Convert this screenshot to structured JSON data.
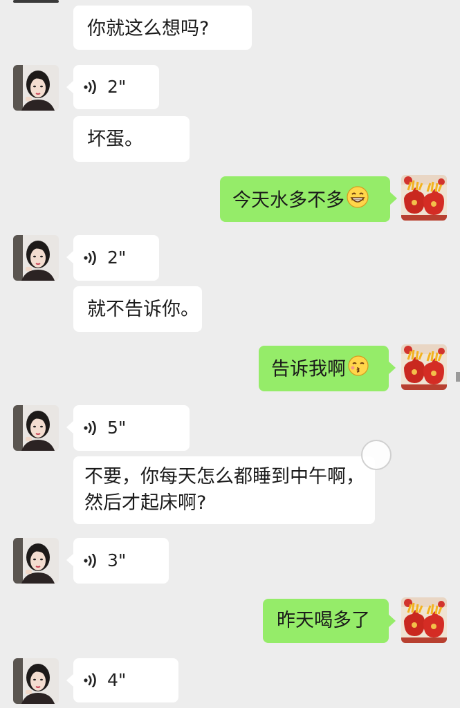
{
  "messages": [
    {
      "side": "in",
      "kind": "text",
      "text": "你就这么想吗?"
    },
    {
      "side": "in",
      "kind": "voice",
      "duration": "2\""
    },
    {
      "side": "in",
      "kind": "text",
      "text": "坏蛋。"
    },
    {
      "side": "out",
      "kind": "text",
      "text": "今天水多不多",
      "emoji": "grinning-emoji"
    },
    {
      "side": "in",
      "kind": "voice",
      "duration": "2\""
    },
    {
      "side": "in",
      "kind": "text",
      "text": "就不告诉你。"
    },
    {
      "side": "out",
      "kind": "text",
      "text": "告诉我啊",
      "emoji": "kissing-emoji"
    },
    {
      "side": "in",
      "kind": "voice",
      "duration": "5\""
    },
    {
      "side": "in",
      "kind": "text",
      "line1": "不要，你每天怎么都睡到中午啊，",
      "line2": "然后才起床啊?"
    },
    {
      "side": "in",
      "kind": "voice",
      "duration": "3\""
    },
    {
      "side": "out",
      "kind": "text",
      "text": "昨天喝多了"
    },
    {
      "side": "in",
      "kind": "voice",
      "duration": "4\""
    }
  ],
  "colors": {
    "background": "#ededed",
    "incoming_bubble": "#ffffff",
    "outgoing_bubble": "#95ec69"
  },
  "icons": {
    "voice": "voice-wave-icon",
    "contact_avatar": "woman-portrait-avatar",
    "self_avatar": "red-lucky-bags-avatar"
  }
}
